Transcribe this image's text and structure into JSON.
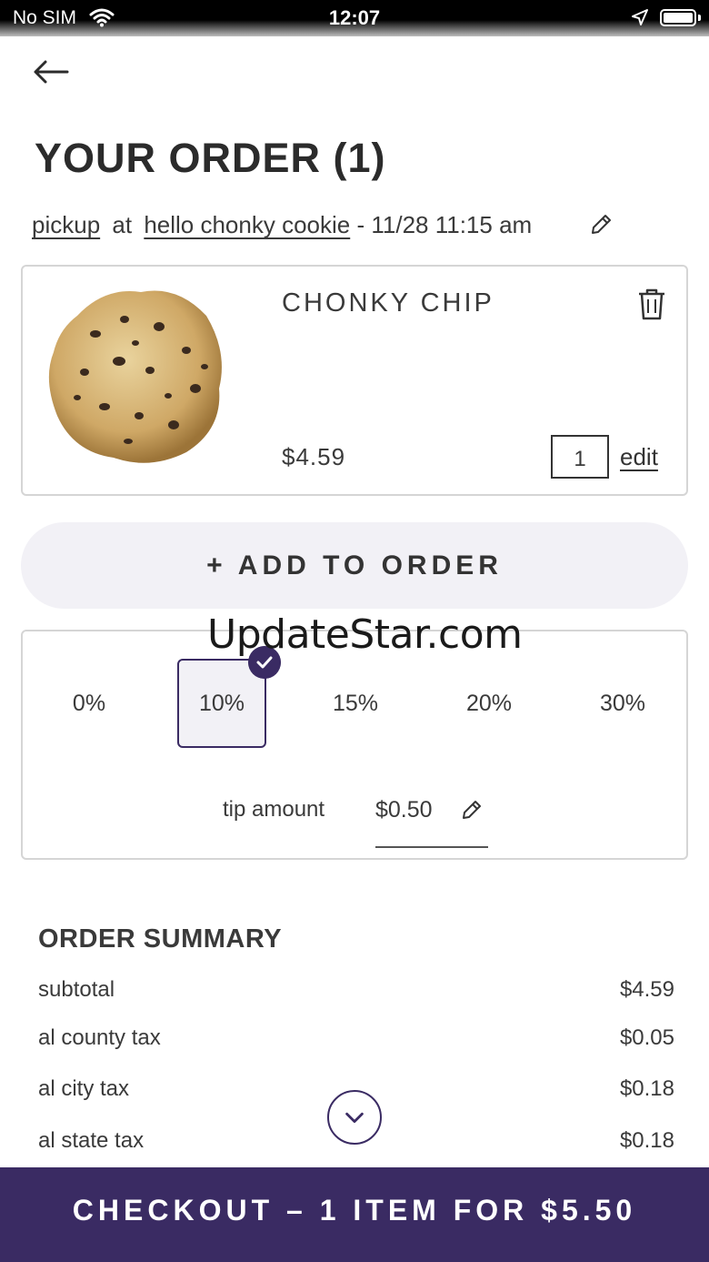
{
  "status_bar": {
    "carrier": "No SIM",
    "time": "12:07"
  },
  "page": {
    "title": "YOUR ORDER (1)"
  },
  "pickup": {
    "mode": "pickup",
    "at": "at",
    "location": "hello chonky cookie",
    "datetime": "- 11/28 11:15 am"
  },
  "item": {
    "name": "CHONKY CHIP",
    "price": "$4.59",
    "quantity": "1",
    "edit_label": "edit"
  },
  "add_to_order": {
    "label": "+ ADD TO ORDER"
  },
  "tip": {
    "options": [
      "0%",
      "10%",
      "15%",
      "20%",
      "30%"
    ],
    "selected": "10%",
    "amount_label": "tip amount",
    "amount_value": "$0.50"
  },
  "watermark": "UpdateStar.com",
  "summary": {
    "title": "ORDER SUMMARY",
    "rows": [
      {
        "label": "subtotal",
        "value": "$4.59"
      },
      {
        "label": "al county tax",
        "value": "$0.05"
      },
      {
        "label": "al city tax",
        "value": "$0.18"
      },
      {
        "label": "al state tax",
        "value": "$0.18"
      }
    ]
  },
  "checkout": {
    "label": "CHECKOUT – 1 ITEM FOR $5.50"
  },
  "colors": {
    "brand": "#3a2b63",
    "button_bg": "#f2f1f6",
    "border": "#d5d5d5"
  },
  "icons": [
    "wifi-icon",
    "location-arrow-icon",
    "battery-icon",
    "back-arrow-icon",
    "pencil-icon",
    "trash-icon",
    "checkmark-icon",
    "chevron-down-icon"
  ]
}
